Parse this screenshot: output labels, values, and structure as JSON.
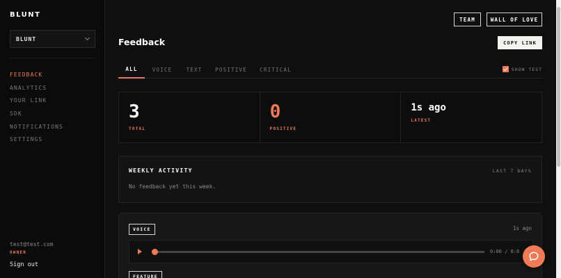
{
  "brand": {
    "logo": "BLUNT",
    "accent": "#f07a55"
  },
  "sidebar": {
    "workspace": "BLUNT",
    "items": [
      {
        "label": "FEEDBACK",
        "active": true
      },
      {
        "label": "ANALYTICS"
      },
      {
        "label": "YOUR LINK"
      },
      {
        "label": "SDK"
      },
      {
        "label": "NOTIFICATIONS"
      },
      {
        "label": "SETTINGS"
      }
    ],
    "user": {
      "email": "test@test.com",
      "role": "OWNER",
      "signout": "Sign out"
    }
  },
  "header": {
    "team": "TEAM",
    "wall": "WALL OF LOVE",
    "copy": "COPY LINK",
    "title": "Feedback"
  },
  "tabs": {
    "all": "ALL",
    "voice": "VOICE",
    "text": "TEXT",
    "positive": "POSITIVE",
    "critical": "CRITICAL",
    "show_test": "SHOW TEST",
    "show_test_checked": true
  },
  "stats": [
    {
      "value": "3",
      "label": "TOTAL"
    },
    {
      "value": "0",
      "label": "POSITIVE"
    },
    {
      "value": "1s ago",
      "label": "LATEST"
    }
  ],
  "weekly": {
    "title": "WEEKLY ACTIVITY",
    "range": "LAST 7 DAYS",
    "empty": "No feedback yet this week."
  },
  "feedback": [
    {
      "badge": "VOICE",
      "ago": "1s ago",
      "time": "0:00 / 0:0",
      "progress": 0
    },
    {
      "badge": "FEATURE"
    }
  ],
  "icons": {
    "chevron": "chevron-down-icon",
    "play": "play-icon",
    "chat": "chat-bubble-icon",
    "check": "checkmark-icon"
  }
}
